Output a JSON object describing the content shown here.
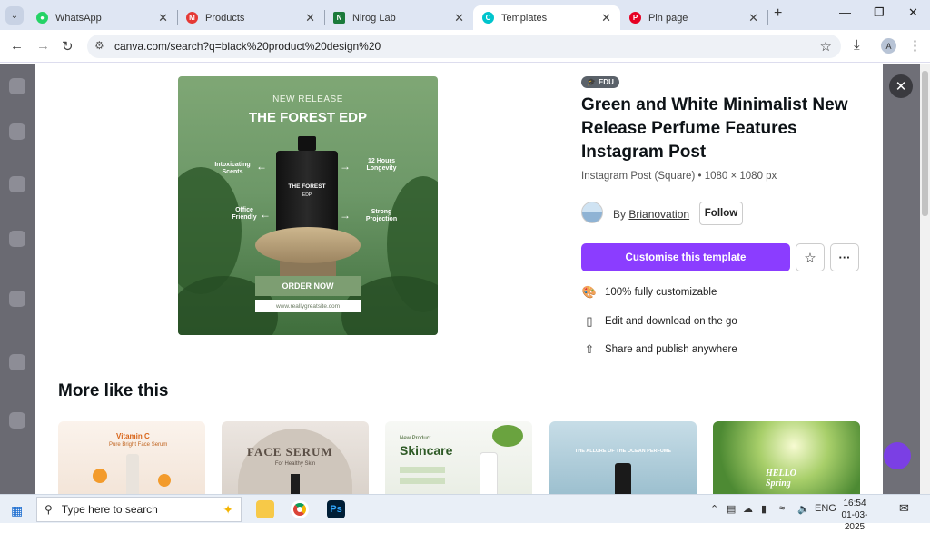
{
  "browser": {
    "tabs": [
      {
        "title": "WhatsApp",
        "fav_color": "#25d366",
        "fav_icon": "whatsapp-icon"
      },
      {
        "title": "Products",
        "fav_color": "#e53935",
        "fav_icon": "products-icon"
      },
      {
        "title": "Nirog Lab",
        "fav_color": "#1b7a3a",
        "fav_icon": "nirog-lab-icon"
      },
      {
        "title": "Templates",
        "fav_color": "#00c4cc",
        "fav_icon": "canva-icon"
      },
      {
        "title": "Pin page",
        "fav_color": "#e60023",
        "fav_icon": "pinterest-icon"
      }
    ],
    "url": "canva.com/search?q=black%20product%20design%20",
    "profile_initial": "A"
  },
  "preview": {
    "kicker": "NEW RELEASE",
    "title": "THE FOREST EDP",
    "bottle_name": "THE FOREST",
    "bottle_sub": "EDP",
    "features": [
      "Intoxicating Scents",
      "12 Hours Longevity",
      "Office Friendly",
      "Strong Projection"
    ],
    "cta": "ORDER NOW",
    "site": "www.reallygreatsite.com"
  },
  "template": {
    "badge": "EDU",
    "title": "Green and White Minimalist New Release Perfume Features Instagram Post",
    "meta": "Instagram Post (Square) • 1080 × 1080 px",
    "author_prefix": "By",
    "author": "Brianovation",
    "follow": "Follow",
    "customise": "Customise this template",
    "features": [
      {
        "icon": "palette-icon",
        "label": "100% fully customizable"
      },
      {
        "icon": "phone-icon",
        "label": "Edit and download on the go"
      },
      {
        "icon": "share-icon",
        "label": "Share and publish anywhere"
      }
    ]
  },
  "more": {
    "heading": "More like this",
    "thumbs": [
      {
        "title": "Vitamin C",
        "sub": "Pure Bright Face Serum"
      },
      {
        "title": "FACE SERUM",
        "sub": "For Healthy Skin"
      },
      {
        "title": "Skincare",
        "sub": "New Product"
      },
      {
        "title": "THE ALLURE OF THE OCEAN PERFUME",
        "sub": ""
      },
      {
        "title": "HELLO Spring",
        "sub": ""
      }
    ]
  },
  "taskbar": {
    "search_placeholder": "Type here to search",
    "lang": "ENG",
    "time": "16:54",
    "date": "01-03-2025"
  }
}
